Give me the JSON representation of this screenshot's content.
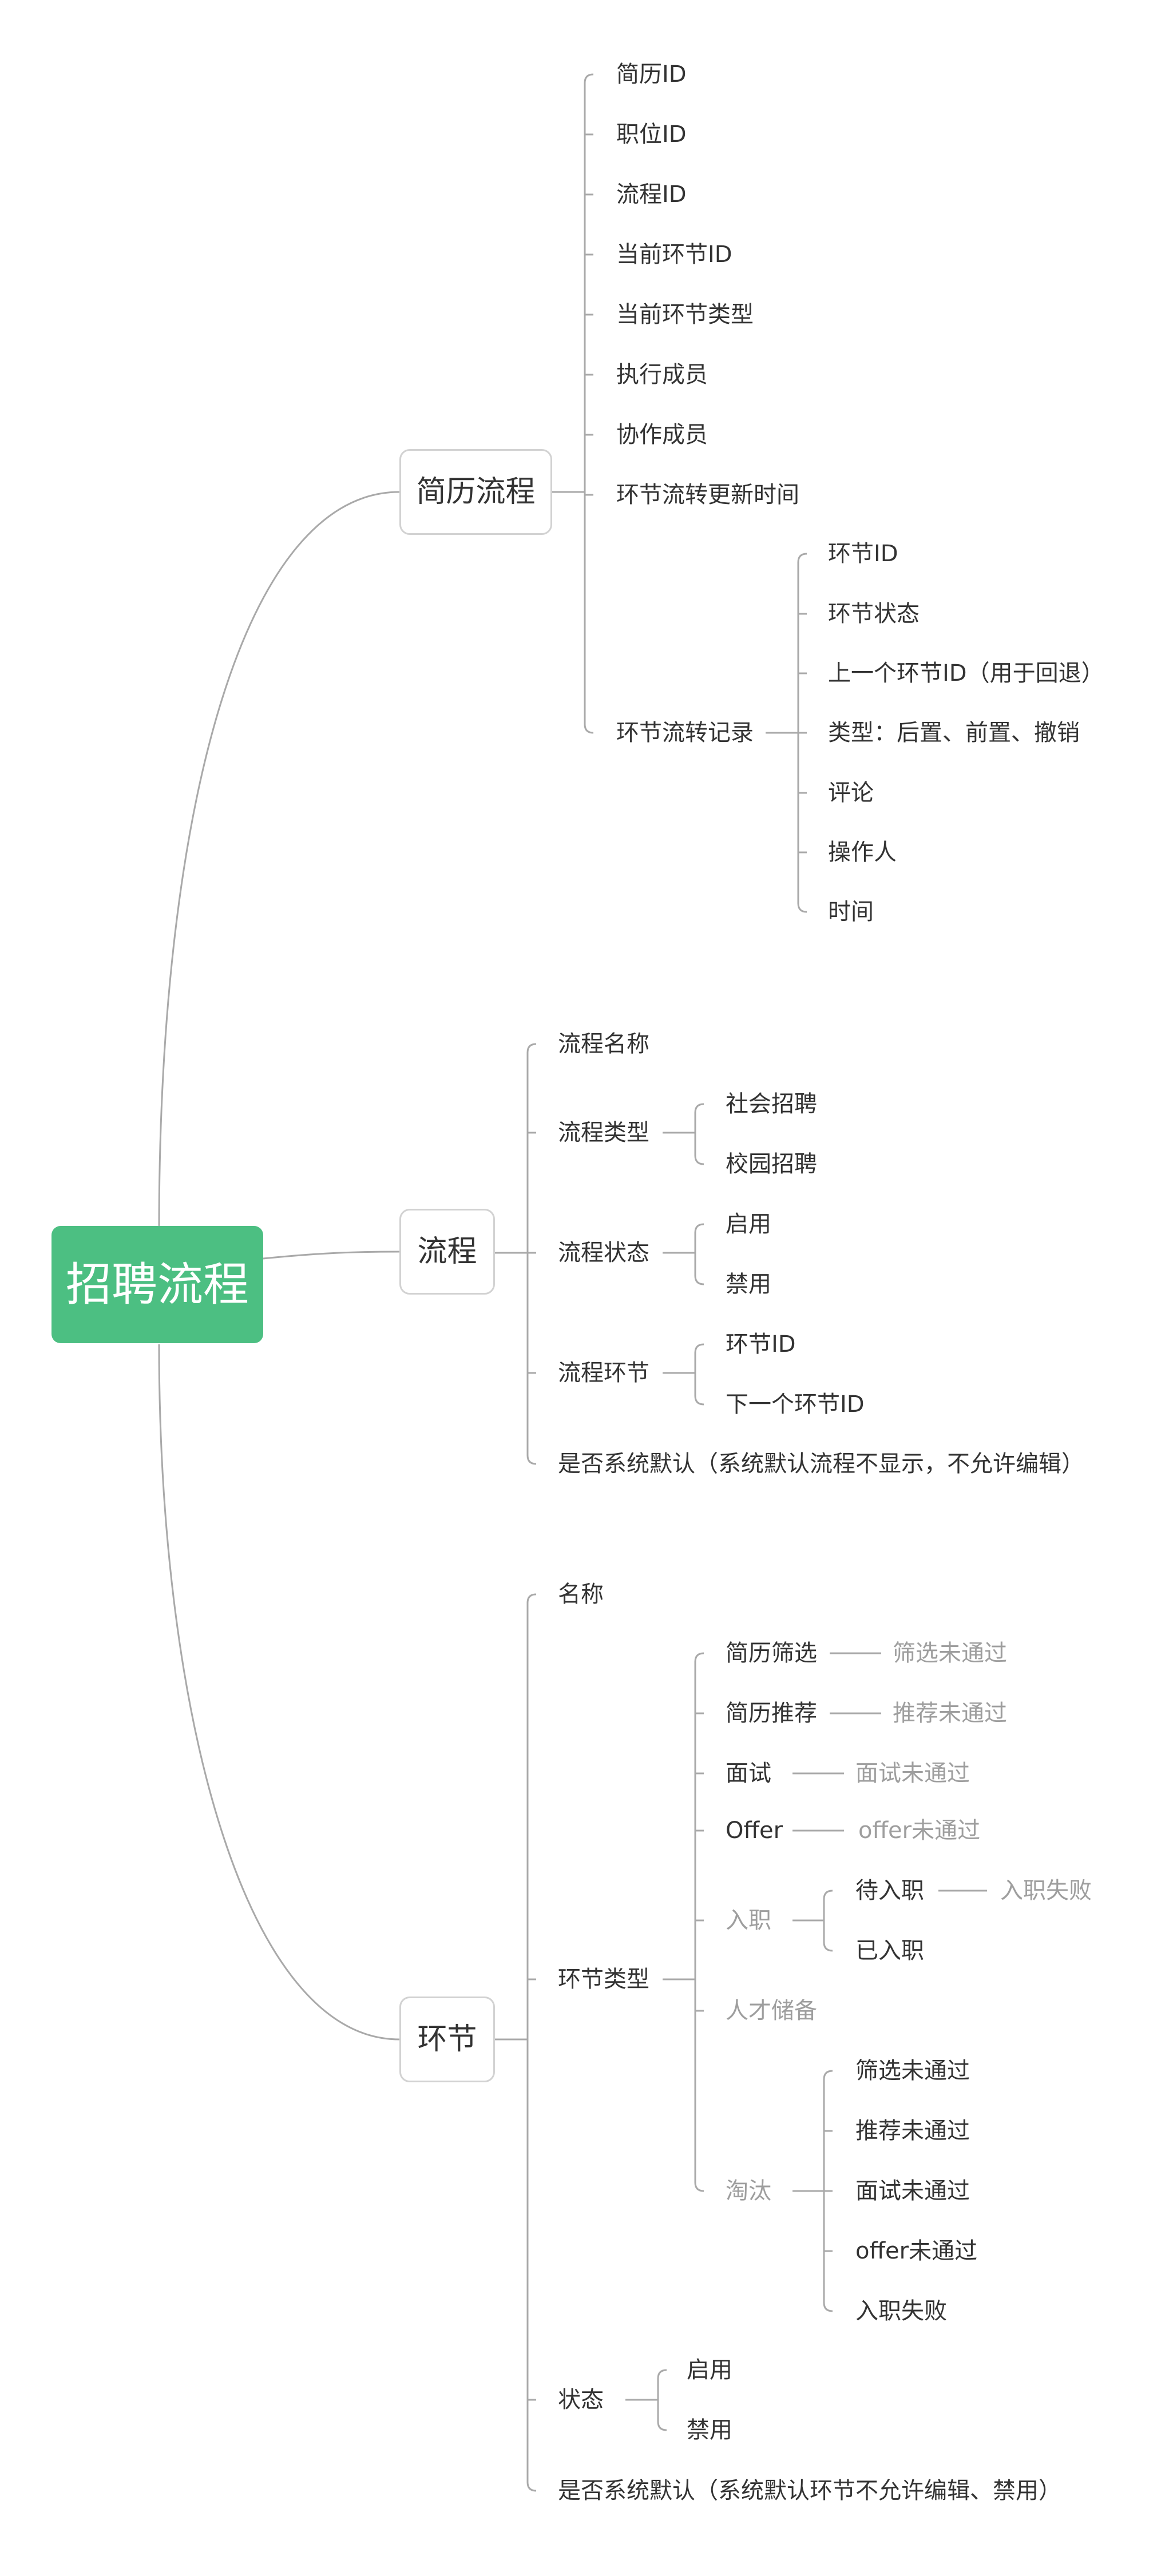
{
  "root": "招聘流程",
  "branches": {
    "resume_flow": {
      "label": "简历流程",
      "items": [
        "简历ID",
        "职位ID",
        "流程ID",
        "当前环节ID",
        "当前环节类型",
        "执行成员",
        "协作成员",
        "环节流转更新时间"
      ],
      "record": {
        "label": "环节流转记录",
        "items": [
          "环节ID",
          "环节状态",
          "上一个环节ID（用于回退）",
          "类型：后置、前置、撤销",
          "评论",
          "操作人",
          "时间"
        ]
      }
    },
    "process": {
      "label": "流程",
      "name": "流程名称",
      "type": {
        "label": "流程类型",
        "items": [
          "社会招聘",
          "校园招聘"
        ]
      },
      "status": {
        "label": "流程状态",
        "items": [
          "启用",
          "禁用"
        ]
      },
      "stages": {
        "label": "流程环节",
        "items": [
          "环节ID",
          "下一个环节ID"
        ]
      },
      "default": "是否系统默认（系统默认流程不显示，不允许编辑）"
    },
    "stage": {
      "label": "环节",
      "name": "名称",
      "type": {
        "label": "环节类型",
        "screening": {
          "label": "简历筛选",
          "fail": "筛选未通过"
        },
        "recommend": {
          "label": "简历推荐",
          "fail": "推荐未通过"
        },
        "interview": {
          "label": "面试",
          "fail": "面试未通过"
        },
        "offer": {
          "label": "Offer",
          "fail": "offer未通过"
        },
        "onboard": {
          "label": "入职",
          "pending": {
            "label": "待入职",
            "fail": "入职失败"
          },
          "done": "已入职"
        },
        "talent_pool": "人才储备",
        "eliminated": {
          "label": "淘汰",
          "items": [
            "筛选未通过",
            "推荐未通过",
            "面试未通过",
            "offer未通过",
            "入职失败"
          ]
        }
      },
      "status": {
        "label": "状态",
        "items": [
          "启用",
          "禁用"
        ]
      },
      "default": "是否系统默认（系统默认环节不允许编辑、禁用）"
    }
  },
  "colors": {
    "root_fill": "#4cbf82",
    "line": "#a9a9a9",
    "text": "#333333",
    "muted_text": "#9e9e9e"
  }
}
